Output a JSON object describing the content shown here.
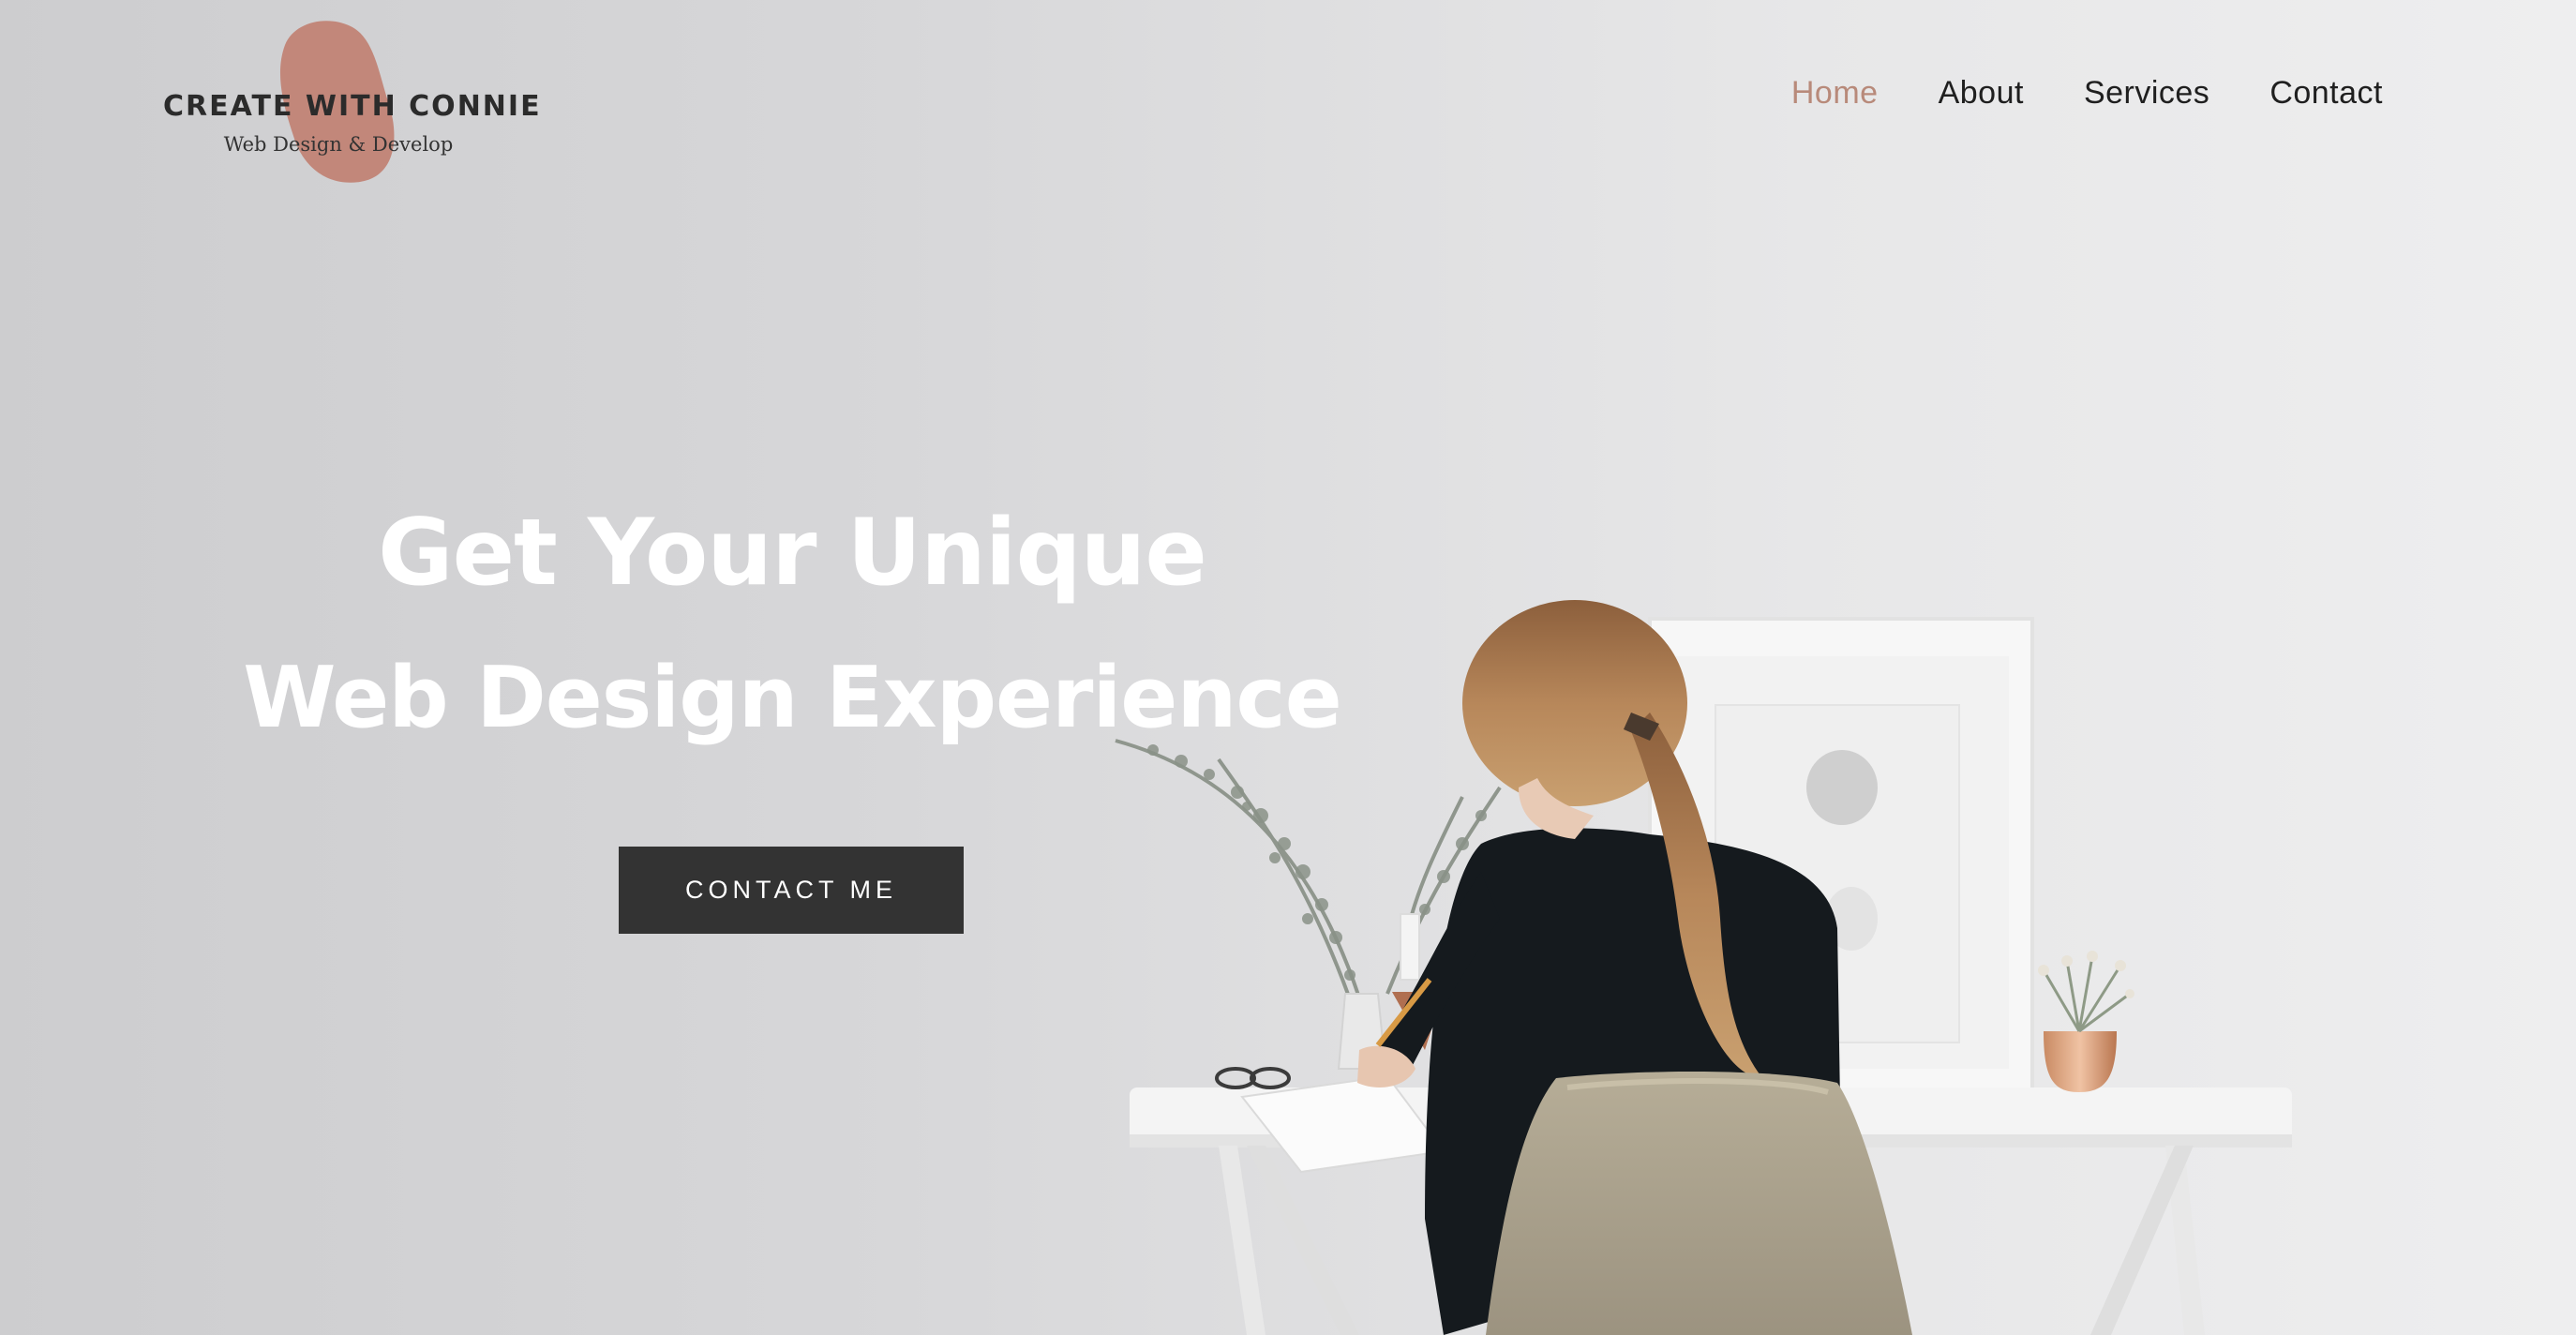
{
  "brand": {
    "title": "CREATE WITH CONNIE",
    "subtitle": "Web Design & Develop",
    "blob_color": "#c2877a"
  },
  "nav": {
    "items": [
      {
        "label": "Home",
        "active": true
      },
      {
        "label": "About",
        "active": false
      },
      {
        "label": "Services",
        "active": false
      },
      {
        "label": "Contact",
        "active": false
      }
    ],
    "active_color": "#b88a7a"
  },
  "hero": {
    "headline_line1": "Get Your Unique",
    "headline_line2": "Web Design Experience",
    "cta_label": "CONTACT ME"
  }
}
